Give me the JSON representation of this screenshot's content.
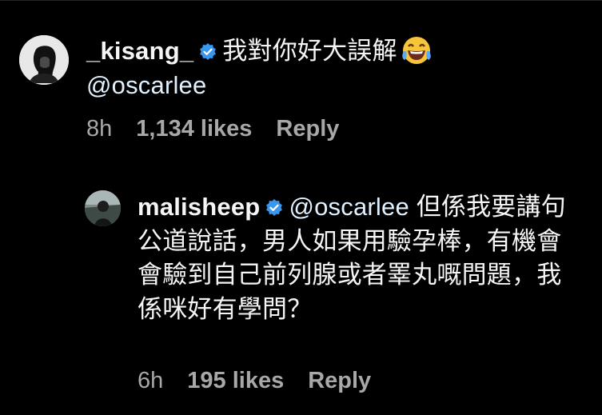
{
  "comments": [
    {
      "username": "_kisang_",
      "verified_icon": "verified-badge-icon",
      "text": "我對你好大誤解",
      "emoji_icon": "laughing-tears-emoji",
      "mention": "@oscarlee",
      "time": "8h",
      "likes": "1,134 likes",
      "reply": "Reply"
    },
    {
      "username": "malisheep",
      "verified_icon": "verified-badge-icon",
      "mention": "@oscarlee",
      "text": " 但係我要講句公道說話，男人如果用驗孕棒，有機會會驗到自己前列腺或者睪丸嘅問題，我係咪好有學問？",
      "time": "6h",
      "likes": "195 likes",
      "reply": "Reply"
    }
  ],
  "colors": {
    "background": "#000000",
    "text": "#f5f5f5",
    "mention": "#e0f1ff",
    "meta": "#a8a8a8",
    "verified": "#3897f0"
  }
}
